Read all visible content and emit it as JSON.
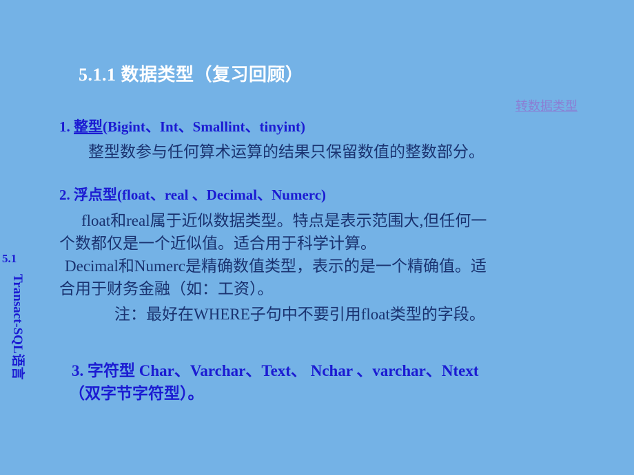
{
  "slide": {
    "background_color": "#74b2e6",
    "title": "5.1.1 数据类型（复习回顾）",
    "title_color": "#ffffff",
    "heading_color": "#1b1bd2",
    "body_color": "#1a3370",
    "link_color": "#8a7fd4"
  },
  "sidebar": {
    "number": "5.1",
    "vertical_label": "Transact-SQL语言"
  },
  "link_note": {
    "text": "转数据类型"
  },
  "sections": {
    "section1": {
      "heading_number": "1. ",
      "heading_underlined": "整型",
      "heading_rest": "(Bigint、Int、Smallint、tinyint)",
      "line1": "整型数参与任何算术运算的结果只保留数值的整数部分。"
    },
    "section2": {
      "heading_number": "2. ",
      "heading_underlined": "浮点型",
      "heading_rest": "(float、real 、Decimal、Numerc)",
      "line1": "float和real属于近似数据类型。特点是表示范围大,但任何一",
      "line2": "个数都仅是一个近似值。适合用于科学计算。",
      "line3": " Decimal和Numerc是精确数值类型，表示的是一个精确值。适",
      "line4": "合用于财务金融（如：工资）。",
      "line5": "注：最好在WHERE子句中不要引用float类型的字段。"
    },
    "section3": {
      "line1": "3. 字符型 Char、Varchar、Text、   Nchar 、varchar、Ntext",
      "line2": "（双字节字符型）。"
    }
  }
}
